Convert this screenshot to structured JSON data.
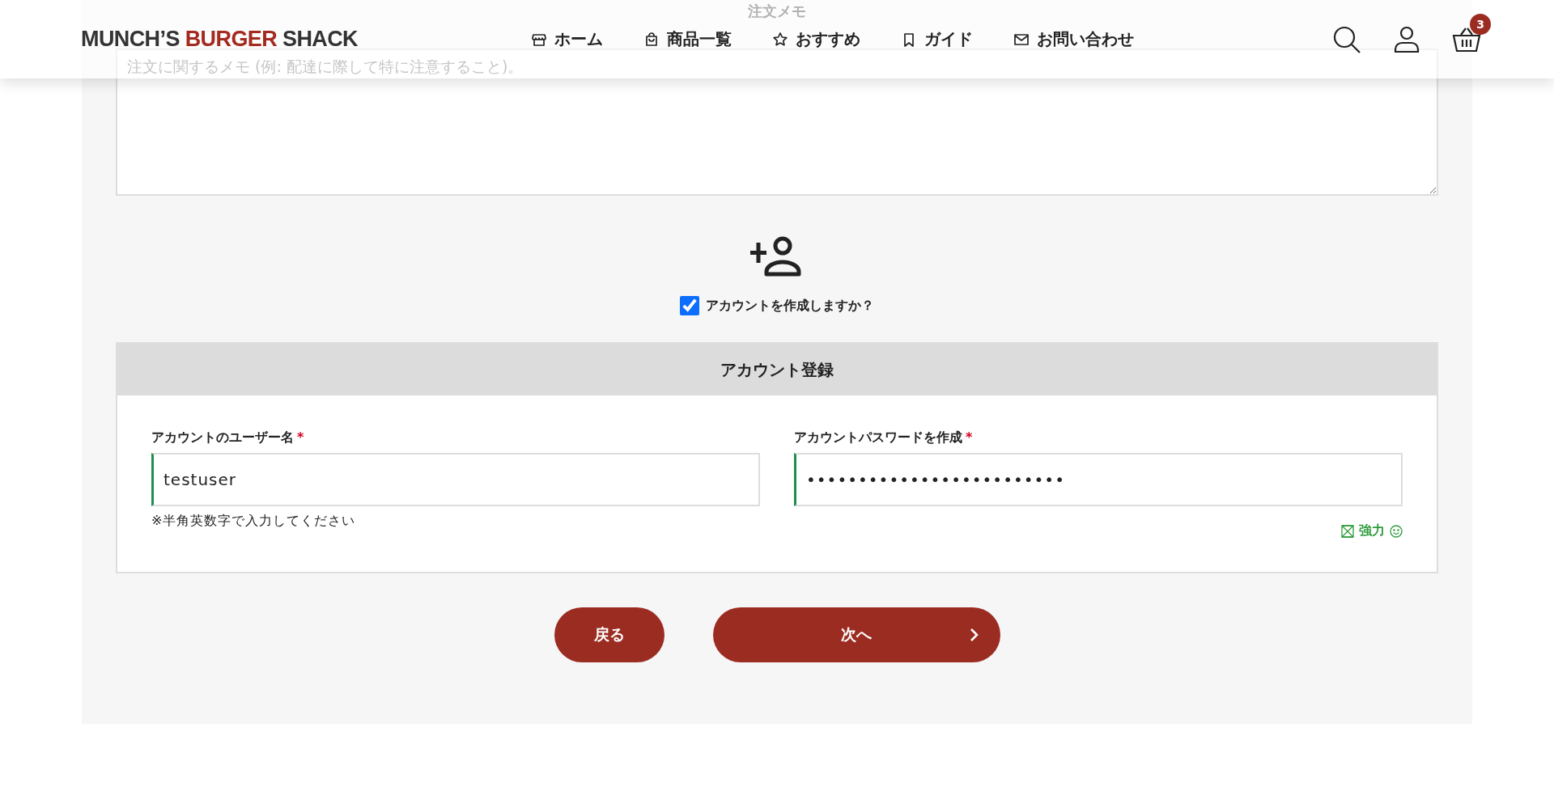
{
  "header": {
    "logo": [
      {
        "text": "MUNCH’S ",
        "accent": false
      },
      {
        "text": "BURGER",
        "accent": true
      },
      {
        "text": " SHACK",
        "accent": false
      }
    ],
    "nav": [
      {
        "label": "ホーム",
        "kind": "store"
      },
      {
        "label": "商品一覧",
        "kind": "bag"
      },
      {
        "label": "おすすめ",
        "kind": "star"
      },
      {
        "label": "ガイド",
        "kind": "bookmark"
      },
      {
        "label": "お問い合わせ",
        "kind": "mail"
      }
    ],
    "cart_count": "3"
  },
  "order_note": {
    "title": "注文メモ",
    "placeholder": "注文に関するメモ (例: 配達に際して特に注意すること)。"
  },
  "create_account": {
    "label": "アカウントを作成しますか？",
    "checked": true
  },
  "account_form": {
    "title": "アカウント登録",
    "fields": [
      {
        "label": "アカウントのユーザー名",
        "required_mark": "*",
        "value": "testuser",
        "valid": true,
        "hint": "※半角英数字で入力してください"
      },
      {
        "label": "アカウントパスワードを作成",
        "required_mark": "*",
        "value": "•••••••••••••••••••••••••",
        "valid": true,
        "strength": "強力"
      }
    ]
  },
  "buttons": {
    "back": "戻る",
    "next": "次へ"
  }
}
